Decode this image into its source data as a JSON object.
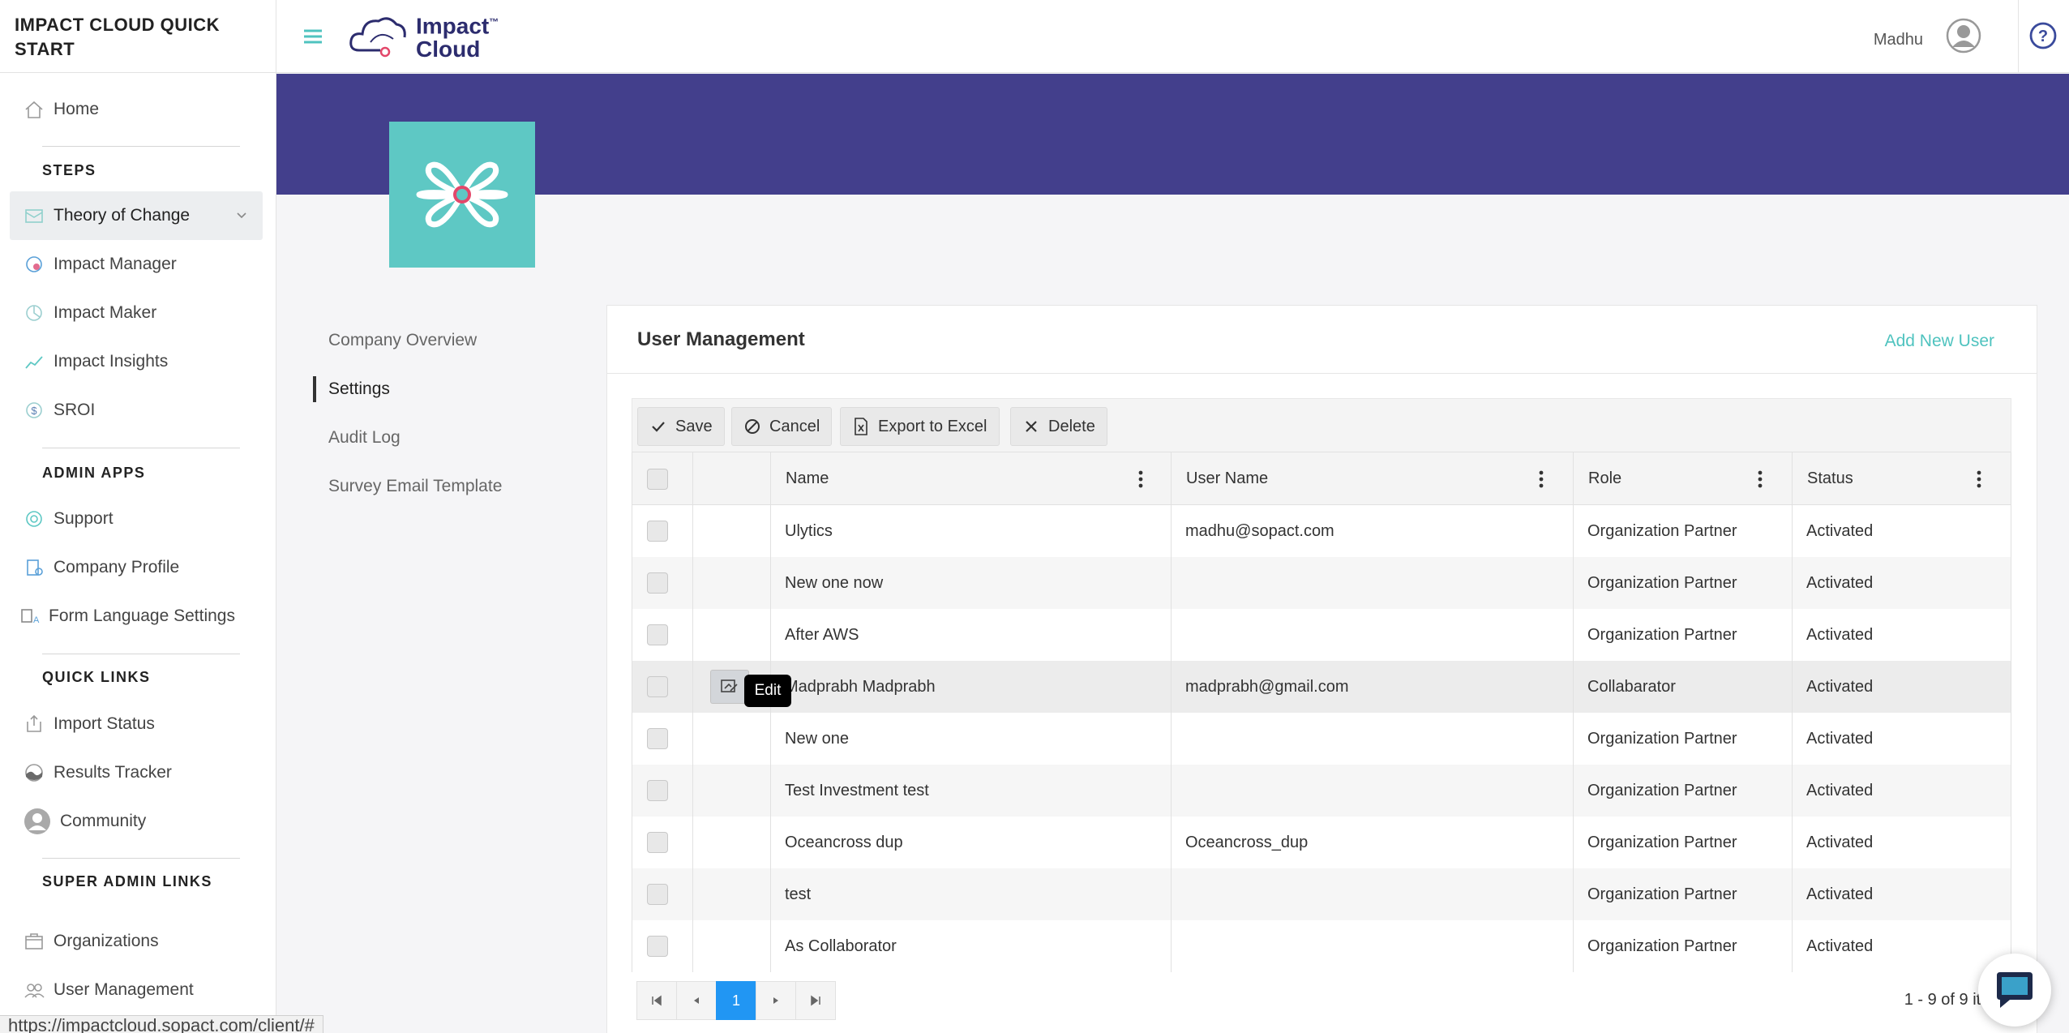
{
  "app": {
    "title": "IMPACT CLOUD QUICK START",
    "logo_text_1": "Impact",
    "logo_text_2": "Cloud",
    "logo_tm": "™"
  },
  "sidebar": {
    "home": "Home",
    "steps_heading": "STEPS",
    "steps": [
      "Theory of Change",
      "Impact Manager",
      "Impact Maker",
      "Impact Insights",
      "SROI"
    ],
    "admin_heading": "ADMIN APPS",
    "admin": [
      "Support",
      "Company Profile",
      "Form Language Settings"
    ],
    "quick_heading": "QUICK LINKS",
    "quick": [
      "Import Status",
      "Results Tracker",
      "Community"
    ],
    "super_heading": "SUPER ADMIN LINKS",
    "super": [
      "Organizations",
      "User Management"
    ]
  },
  "topbar": {
    "user_name": "Madhu"
  },
  "left_nav": [
    "Company Overview",
    "Settings",
    "Audit Log",
    "Survey Email Template"
  ],
  "card": {
    "title": "User Management",
    "add_user": "Add New User"
  },
  "toolbar": {
    "save": "Save",
    "cancel": "Cancel",
    "export": "Export to Excel",
    "delete": "Delete"
  },
  "grid": {
    "columns": [
      "Name",
      "User Name",
      "Role",
      "Status"
    ],
    "rows": [
      {
        "name": "Ulytics",
        "username": "madhu@sopact.com",
        "role": "Organization Partner",
        "status": "Activated"
      },
      {
        "name": "New one now",
        "username": "",
        "role": "Organization Partner",
        "status": "Activated"
      },
      {
        "name": "After AWS",
        "username": "",
        "role": "Organization Partner",
        "status": "Activated"
      },
      {
        "name": "Madprabh Madprabh",
        "username": "madprabh@gmail.com",
        "role": "Collabarator",
        "status": "Activated"
      },
      {
        "name": "New one",
        "username": "",
        "role": "Organization Partner",
        "status": "Activated"
      },
      {
        "name": "Test Investment test",
        "username": "",
        "role": "Organization Partner",
        "status": "Activated"
      },
      {
        "name": "Oceancross dup",
        "username": "Oceancross_dup",
        "role": "Organization Partner",
        "status": "Activated"
      },
      {
        "name": "test",
        "username": "",
        "role": "Organization Partner",
        "status": "Activated"
      },
      {
        "name": "As Collaborator",
        "username": "",
        "role": "Organization Partner",
        "status": "Activated"
      }
    ],
    "edit_tooltip": "Edit"
  },
  "pager": {
    "current_page": "1",
    "info": "1 - 9 of 9 items"
  },
  "statusbar": {
    "url": "https://impactcloud.sopact.com/client/#"
  },
  "colors": {
    "banner": "#433f8c",
    "accent": "#4fc3bf",
    "logo_bg": "#5ec8c4",
    "page_active": "#2196f3"
  }
}
